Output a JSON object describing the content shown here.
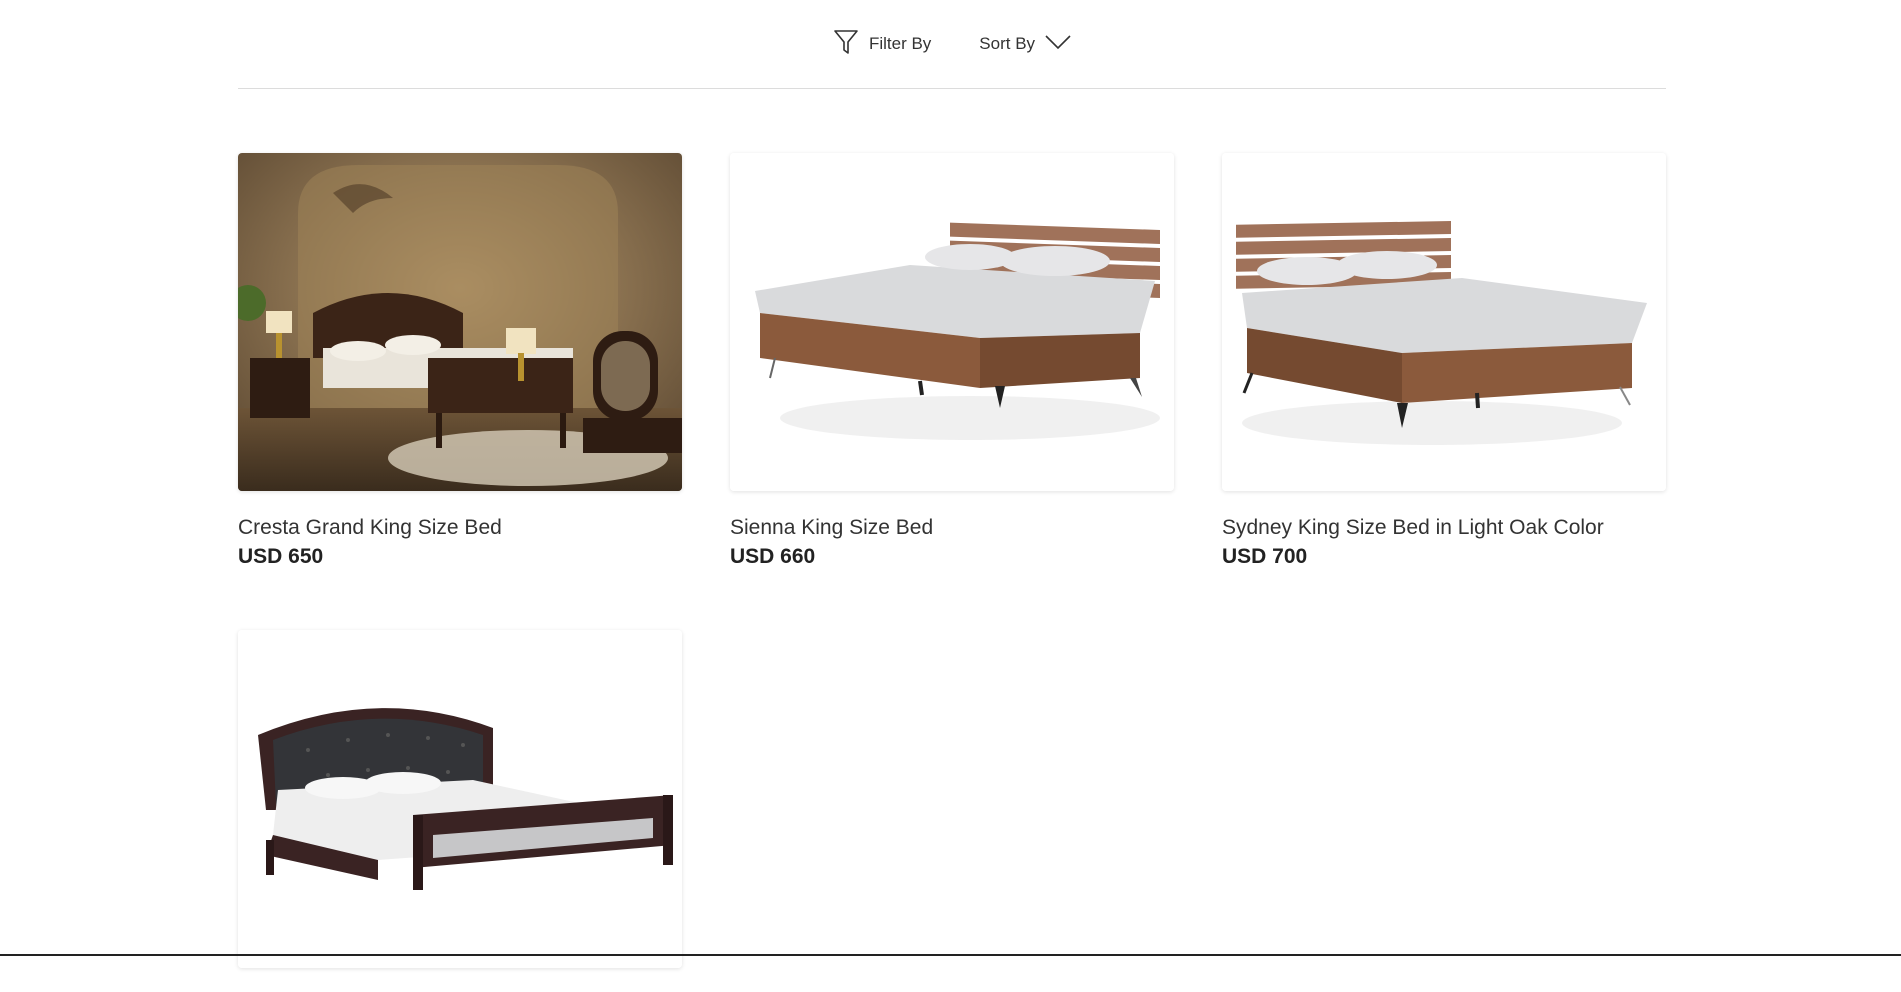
{
  "toolbar": {
    "filter_label": "Filter By",
    "sort_label": "Sort By",
    "filter_icon": "funnel-icon",
    "sort_icon": "chevron-down-icon"
  },
  "products": [
    {
      "title": "Cresta Grand King Size Bed",
      "price": "USD 650"
    },
    {
      "title": "Sienna King Size Bed",
      "price": "USD 660"
    },
    {
      "title": "Sydney King Size Bed in Light Oak Color",
      "price": "USD 700"
    },
    {
      "title": "",
      "price": ""
    }
  ]
}
